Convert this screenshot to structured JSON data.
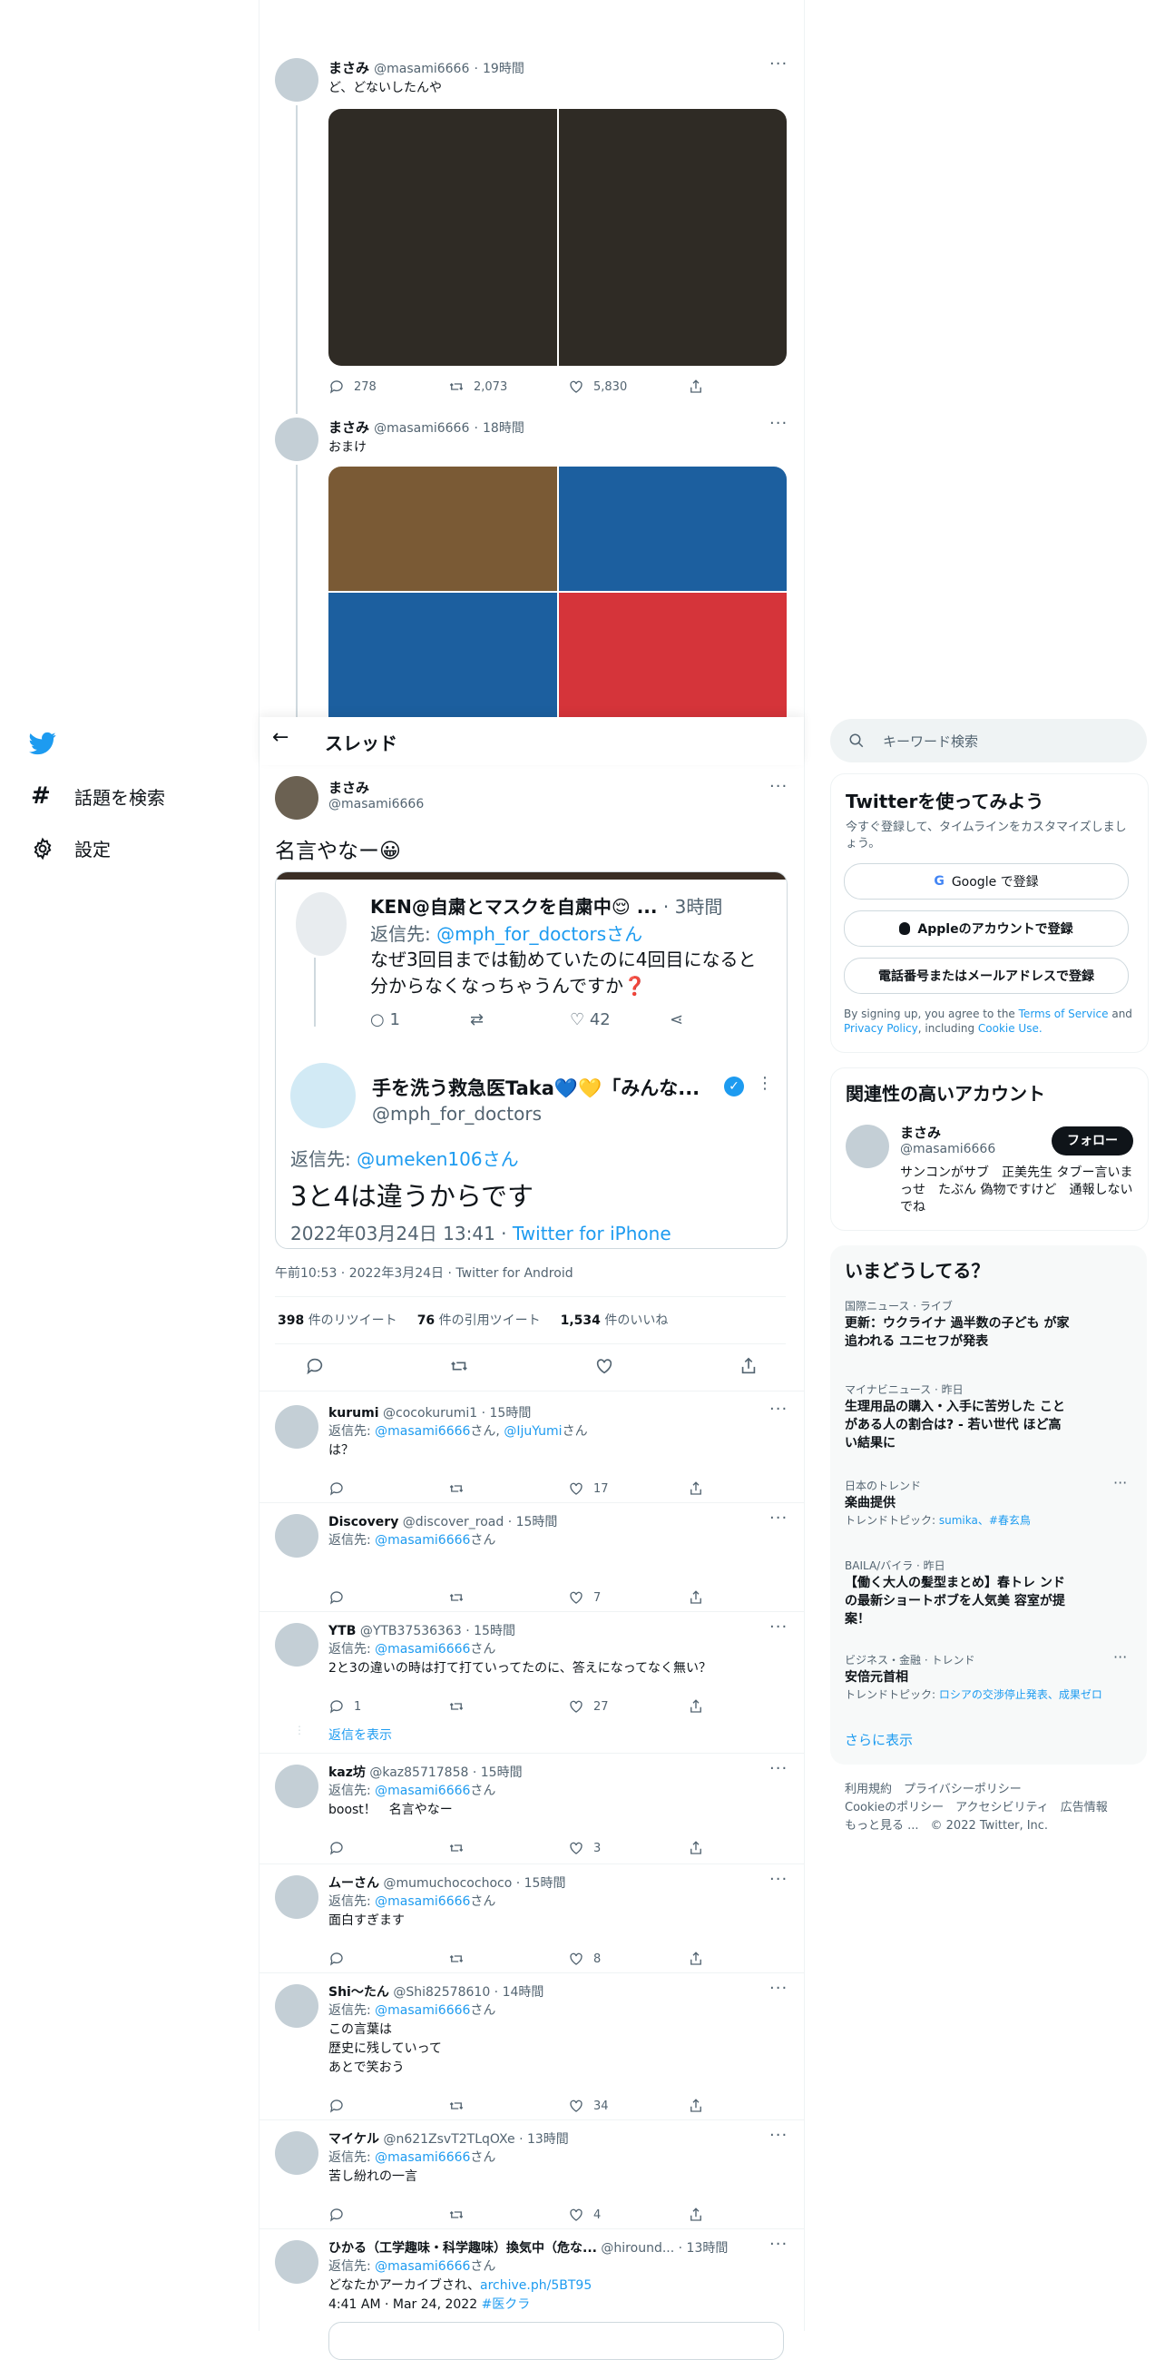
{
  "nav": {
    "explore_label": "話題を検索",
    "settings_label": "設定"
  },
  "thread_prev": [
    {
      "name": "まさみ",
      "handle": "@masami6666",
      "time": "19時間",
      "text": "ど、どないしたんや",
      "replies": "278",
      "retweets": "2,073",
      "likes": "5,830"
    },
    {
      "name": "まさみ",
      "handle": "@masami6666",
      "time": "18時間",
      "text": "おまけ"
    }
  ],
  "header": {
    "title": "スレッド"
  },
  "main_tweet": {
    "name": "まさみ",
    "handle": "@masami6666",
    "text": "名言やなー😀",
    "quoted": {
      "reply_name": "KEN@自粛とマスクを自粛中😌 ...",
      "reply_time": "· 3時間",
      "reply_to_prefix": "返信先: ",
      "reply_to_handle": "@mph_for_doctorsさん",
      "reply_text": "なぜ3回目までは勧めていたのに4回目になると分からなくなっちゃうんですか❓",
      "reply_replies": "1",
      "reply_likes": "42",
      "main_name": "手を洗う救急医Taka💙💛「みんな...",
      "main_handle": "@mph_for_doctors",
      "main_reply_prefix": "返信先: ",
      "main_reply_handle": "@umeken106さん",
      "main_text": "3と4は違うからです",
      "main_date": "2022年03月24日 13:41 · ",
      "main_source": "Twitter for iPhone"
    },
    "timestamp": "午前10:53 · 2022年3月24日 · Twitter for Android",
    "retweets": "398",
    "retweets_label": "件のリツイート",
    "quotes": "76",
    "quotes_label": "件の引用ツイート",
    "likes": "1,534",
    "likes_label": "件のいいね"
  },
  "replies": [
    {
      "name": "kurumi",
      "handle": "@cocokurumi1",
      "time": "15時間",
      "reply_prefix": "返信先: ",
      "reply_to": "@masami6666",
      "reply_suffix": "さん, ",
      "reply_to2": "@IjuYumi",
      "reply_suffix2": "さん",
      "lines": [
        "は？"
      ],
      "replies": "",
      "retweets": "",
      "likes": "17"
    },
    {
      "name": "Discovery",
      "handle": "@discover_road",
      "time": "15時間",
      "reply_prefix": "返信先: ",
      "reply_to": "@masami6666",
      "reply_suffix": "さん",
      "lines": [],
      "replies": "",
      "retweets": "",
      "likes": "7"
    },
    {
      "name": "YTB",
      "handle": "@YTB37536363",
      "time": "15時間",
      "reply_prefix": "返信先: ",
      "reply_to": "@masami6666",
      "reply_suffix": "さん",
      "lines": [
        "2と3の違いの時は打て打ていってたのに、答えになってなく無い？"
      ],
      "replies": "1",
      "retweets": "",
      "likes": "27",
      "show_replies": "返信を表示"
    },
    {
      "name": "kaz坊",
      "handle": "@kaz85717858",
      "time": "15時間",
      "reply_prefix": "返信先: ",
      "reply_to": "@masami6666",
      "reply_suffix": "さん",
      "lines": [
        "boost！　名言やなー"
      ],
      "replies": "",
      "retweets": "",
      "likes": "3"
    },
    {
      "name": "ムーさん",
      "handle": "@mumuchocochoco",
      "time": "15時間",
      "reply_prefix": "返信先: ",
      "reply_to": "@masami6666",
      "reply_suffix": "さん",
      "lines": [
        "面白すぎます"
      ],
      "replies": "",
      "retweets": "",
      "likes": "8"
    },
    {
      "name": "Shi〜たん",
      "handle": "@Shi82578610",
      "time": "14時間",
      "reply_prefix": "返信先: ",
      "reply_to": "@masami6666",
      "reply_suffix": "さん",
      "lines": [
        "この言葉は",
        "歴史に残していって",
        "あとで笑おう"
      ],
      "replies": "",
      "retweets": "",
      "likes": "34"
    },
    {
      "name": "マイケル",
      "handle": "@n621ZsvT2TLqOXe",
      "time": "13時間",
      "reply_prefix": "返信先: ",
      "reply_to": "@masami6666",
      "reply_suffix": "さん",
      "lines": [
        "苦し紛れの一言"
      ],
      "replies": "",
      "retweets": "",
      "likes": "4"
    },
    {
      "name": "ひかる（工学趣味・科学趣味）換気中（危な...",
      "handle": "@hiround...",
      "time": "13時間",
      "reply_prefix": "返信先: ",
      "reply_to": "@masami6666",
      "reply_suffix": "さん",
      "lines": [
        "どなたかアーカイブされ、"
      ],
      "link_text": "archive.ph/5BT95",
      "line2": "4:41 AM · Mar 24, 2022 ",
      "hashtag": "#医クラ",
      "replies": "",
      "retweets": "",
      "likes": ""
    }
  ],
  "search": {
    "placeholder": "キーワード検索"
  },
  "signup": {
    "title": "Twitterを使ってみよう",
    "subtitle": "今すぐ登録して、タイムラインをカスタマイズしましょう。",
    "google": "Google で登録",
    "apple": "Appleのアカウントで登録",
    "phone": "電話番号またはメールアドレスで登録",
    "terms_pre": "By signing up, you agree to the ",
    "terms": "Terms of Service",
    "and": " and ",
    "privacy": "Privacy Policy",
    "including": ", including ",
    "cookie": "Cookie Use."
  },
  "relevant": {
    "title": "関連性の高いアカウント",
    "name": "まさみ",
    "handle": "@masami6666",
    "follow": "フォロー",
    "bio": "サンコンがサブ　正美先生 タブー言いまっせ　たぶん 偽物ですけど　通報しないでね"
  },
  "trends": {
    "title": "いまどうしてる？",
    "items": [
      {
        "context": "国際ニュース · ライブ",
        "headline": "更新：ウクライナ 過半数の子ども が家追われる ユニセフが発表"
      },
      {
        "context": "マイナビニュース · 昨日",
        "headline": "生理用品の購入・入手に苦労した ことがある人の割合は? - 若い世代 ほど高い結果に"
      },
      {
        "context": "日本のトレンド",
        "headline": "楽曲提供",
        "topic_pre": "トレンドトピック: ",
        "topic": "sumika、#春玄鳥"
      },
      {
        "context": "BAILA/バイラ · 昨日",
        "headline": "【働く大人の髪型まとめ】春トレ ンドの最新ショートボブを人気美 容室が提案！"
      },
      {
        "context": "ビジネス・金融 · トレンド",
        "headline": "安倍元首相",
        "topic_pre": "トレンドトピック: ",
        "topic": "ロシアの交渉停止発表、成果ゼロ"
      }
    ],
    "more": "さらに表示"
  },
  "footer": {
    "line1": "利用規約　プライバシーポリシー",
    "line2": "Cookieのポリシー　アクセシビリティ　広告情報",
    "line3": "もっと見る ...　© 2022 Twitter, Inc."
  },
  "colors": {
    "accent": "#1d9bf0",
    "image_dark": "#2f2b25",
    "image_brown": "#7a5a35",
    "image_blue": "#1c5f9f",
    "image_red": "#d5343a"
  }
}
